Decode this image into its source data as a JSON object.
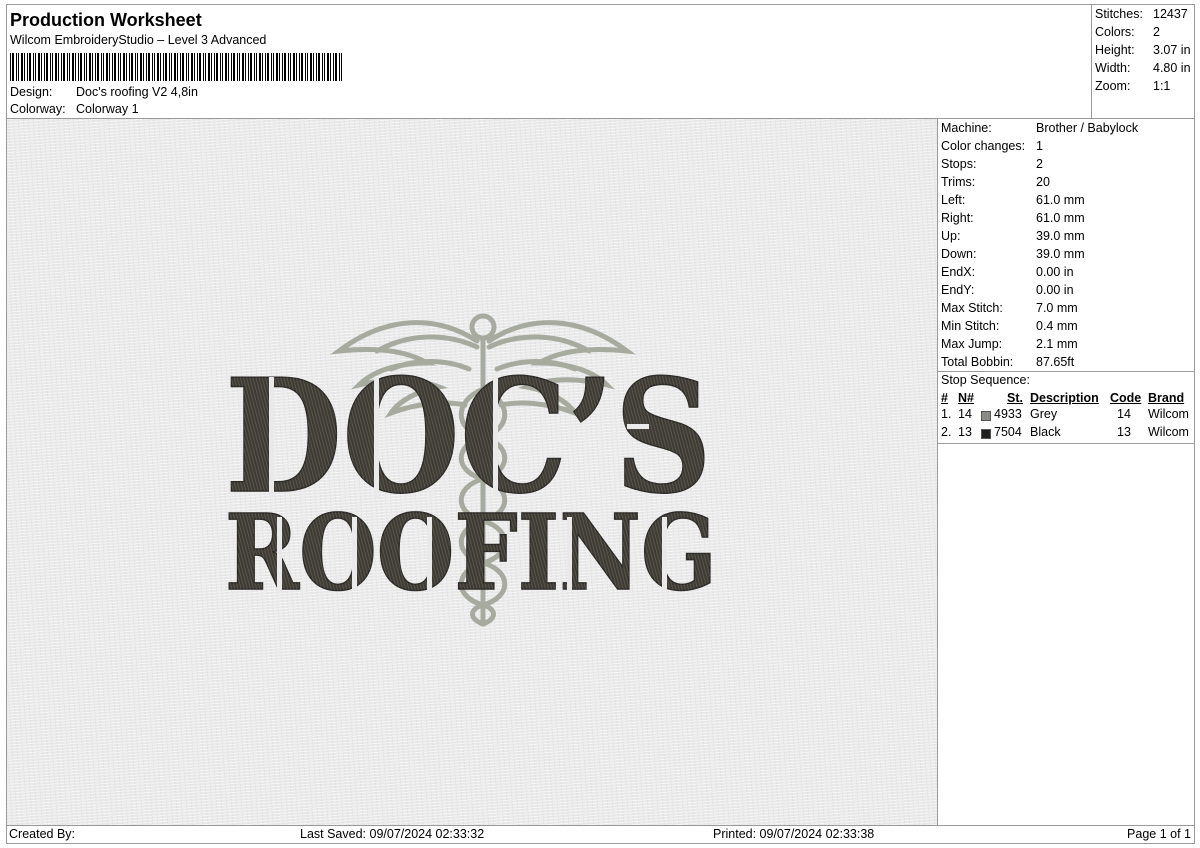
{
  "header": {
    "title": "Production Worksheet",
    "subtitle": "Wilcom EmbroideryStudio – Level 3 Advanced",
    "design_label": "Design:",
    "design_value": "Doc's roofing V2 4,8in",
    "colorway_label": "Colorway:",
    "colorway_value": "Colorway 1"
  },
  "summary": {
    "stitches_label": "Stitches:",
    "stitches_value": "12437",
    "colors_label": "Colors:",
    "colors_value": "2",
    "height_label": "Height:",
    "height_value": "3.07 in",
    "width_label": "Width:",
    "width_value": "4.80 in",
    "zoom_label": "Zoom:",
    "zoom_value": "1:1"
  },
  "details": [
    {
      "label": "Machine:",
      "value": "Brother / Babylock"
    },
    {
      "label": "Color changes:",
      "value": "1"
    },
    {
      "label": "Stops:",
      "value": "2"
    },
    {
      "label": "Trims:",
      "value": "20"
    },
    {
      "label": "Left:",
      "value": "61.0 mm"
    },
    {
      "label": "Right:",
      "value": "61.0 mm"
    },
    {
      "label": "Up:",
      "value": "39.0 mm"
    },
    {
      "label": "Down:",
      "value": "39.0 mm"
    },
    {
      "label": "EndX:",
      "value": "0.00 in"
    },
    {
      "label": "EndY:",
      "value": "0.00 in"
    },
    {
      "label": "Max Stitch:",
      "value": "7.0 mm"
    },
    {
      "label": "Min Stitch:",
      "value": "0.4 mm"
    },
    {
      "label": "Max Jump:",
      "value": "2.1 mm"
    },
    {
      "label": "Total Bobbin:",
      "value": "87.65ft"
    }
  ],
  "stop_sequence": {
    "title": "Stop Sequence:",
    "headers": {
      "num": "#",
      "n": "N#",
      "st": "St.",
      "description": "Description",
      "code": "Code",
      "brand": "Brand"
    },
    "rows": [
      {
        "num": "1.",
        "n": "14",
        "color": "#8a8a86",
        "st": "4933",
        "description": "Grey",
        "code": "14",
        "brand": "Wilcom"
      },
      {
        "num": "2.",
        "n": "13",
        "color": "#1e1e1c",
        "st": "7504",
        "description": "Black",
        "code": "13",
        "brand": "Wilcom"
      }
    ]
  },
  "design_artwork": {
    "line1": "DOC’S",
    "line2": "ROOFING",
    "thread_dark": "#3e3b34",
    "thread_grey": "#a7ab9f",
    "fabric": "#e9e9e9"
  },
  "footer": {
    "created_by": "Created By:",
    "last_saved": "Last Saved: 09/07/2024 02:33:32",
    "printed": "Printed: 09/07/2024 02:33:38",
    "page": "Page 1 of 1"
  }
}
